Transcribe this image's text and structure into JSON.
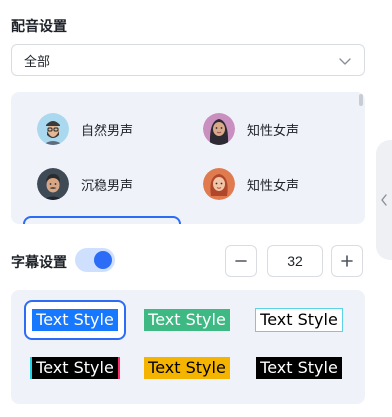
{
  "dubbing": {
    "title": "配音设置",
    "filter": {
      "value": "全部",
      "icon": "chevron-down-icon"
    },
    "voices": [
      {
        "label": "自然男声",
        "avatar": "bearded-man-avatar"
      },
      {
        "label": "知性女声",
        "avatar": "hijab-woman-avatar"
      },
      {
        "label": "沉稳男声",
        "avatar": "mustache-man-avatar"
      },
      {
        "label": "知性女声",
        "avatar": "red-hair-woman-avatar"
      }
    ]
  },
  "subtitle": {
    "title": "字幕设置",
    "enabled": true,
    "font_size": "32",
    "decrement_icon": "minus-icon",
    "increment_icon": "plus-icon",
    "styles": [
      {
        "label": "Text Style",
        "fg": "#ffffff",
        "bg": "#1677ff",
        "selected": true
      },
      {
        "label": "Text Style",
        "fg": "#ffffff",
        "bg": "#3fb984",
        "selected": false
      },
      {
        "label": "Text Style",
        "fg": "#000000",
        "bg": "#ffffff",
        "selected": false
      },
      {
        "label": "Text Style",
        "fg": "#ffffff",
        "bg": "#000000",
        "selected": false
      },
      {
        "label": "Text Style",
        "fg": "#000000",
        "bg": "#f5b400",
        "selected": false
      },
      {
        "label": "Text Style",
        "fg": "#ffffff",
        "bg": "#000000",
        "selected": false
      }
    ]
  },
  "side_panel": {
    "toggle_icon": "chevron-left-icon"
  },
  "colors": {
    "accent": "#2d6cf6",
    "panel_bg": "#eff2f8"
  }
}
